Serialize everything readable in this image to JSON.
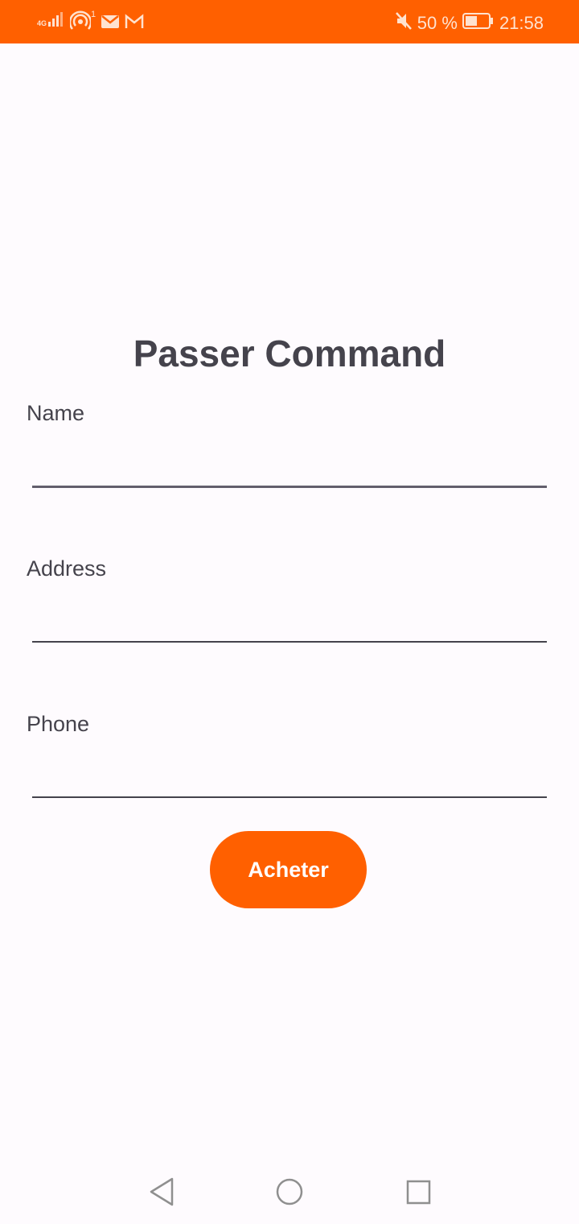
{
  "status_bar": {
    "network_type": "4G",
    "hotspot_count": "1",
    "battery": "50 %",
    "time": "21:58",
    "icons": [
      "signal-icon",
      "hotspot-icon",
      "mail-icon",
      "gmail-icon",
      "mute-icon",
      "battery-icon"
    ]
  },
  "page": {
    "title": "Passer Command"
  },
  "form": {
    "name_label": "Name",
    "name_value": "",
    "address_label": "Address",
    "address_value": "",
    "phone_label": "Phone",
    "phone_value": "",
    "submit_label": "Acheter"
  },
  "nav": {
    "icons": [
      "back-icon",
      "home-icon",
      "recents-icon"
    ]
  },
  "colors": {
    "accent": "#ff6000",
    "background": "#fefbfe",
    "text": "#45434c"
  }
}
